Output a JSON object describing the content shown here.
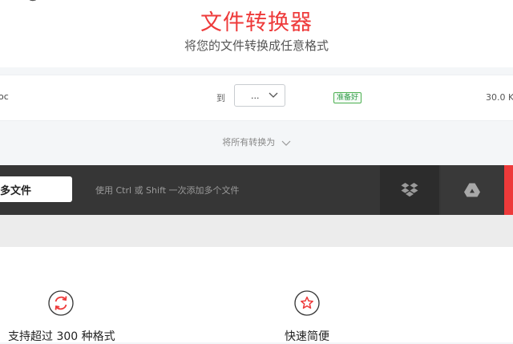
{
  "header": {
    "title": "文件转换器",
    "subtitle": "将您的文件转换成任意格式"
  },
  "file_row": {
    "file_name": "oc",
    "to_label": "到",
    "format_value": "...",
    "status": "准备好",
    "size": "30.0 K"
  },
  "convert_all": {
    "label": "将所有转换为"
  },
  "toolbar": {
    "add_button_label": "多文件",
    "hint": "使用 Ctrl 或 Shift 一次添加多个文件",
    "dropbox_icon": "dropbox-icon",
    "drive_icon": "google-drive-icon"
  },
  "features": [
    {
      "icon": "convert-cycle-icon",
      "label": "支持超过 300 种格式"
    },
    {
      "icon": "star-icon",
      "label": "快速简便"
    }
  ],
  "colors": {
    "accent": "#ee3a3a",
    "toolbar": "#363636",
    "ready_green": "#2e9b47"
  }
}
